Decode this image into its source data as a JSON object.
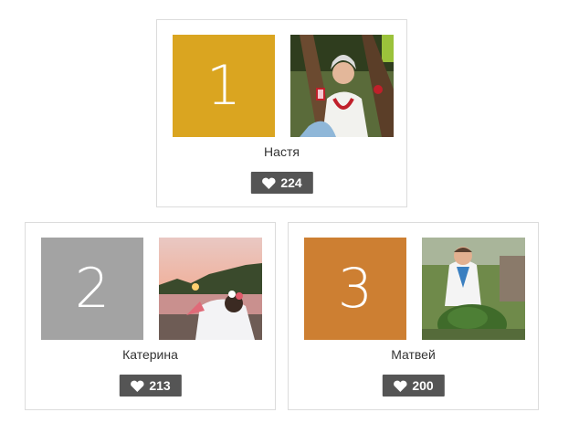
{
  "entries": [
    {
      "rank": "1",
      "name": "Настя",
      "likes": "224",
      "rank_color": "#DAA520",
      "heart_icon": "heart-icon"
    },
    {
      "rank": "2",
      "name": "Катерина",
      "likes": "213",
      "rank_color": "#A3A3A3",
      "heart_icon": "heart-icon"
    },
    {
      "rank": "3",
      "name": "Матвей",
      "likes": "200",
      "rank_color": "#CD7F32",
      "heart_icon": "heart-icon"
    }
  ],
  "colors": {
    "like_button_bg": "#555555",
    "card_border": "#DCDCDC"
  }
}
